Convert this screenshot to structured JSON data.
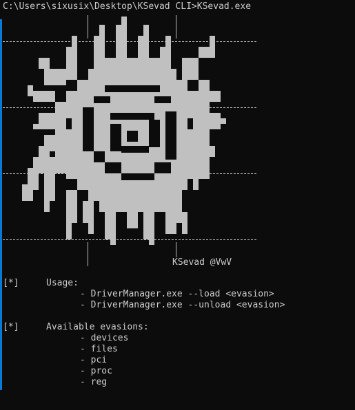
{
  "terminal": {
    "prompt": "C:\\Users\\sixusix\\Desktop\\KSevad CLI>",
    "command": "KSevad.exe"
  },
  "banner": {
    "signature": "KSevad @VwV"
  },
  "usage": {
    "marker": "[*]",
    "heading": "Usage:",
    "lines": [
      "- DriverManager.exe --load <evasion>",
      "- DriverManager.exe --unload <evasion>"
    ]
  },
  "evasions": {
    "marker": "[*]",
    "heading": "Available evasions:",
    "items": [
      "- devices",
      "- files",
      "- pci",
      "- proc",
      "- reg"
    ]
  },
  "colors": {
    "background": "#0c0c0c",
    "text": "#cccccc",
    "logo": "#c0c0c0",
    "accent": "#0a78d7"
  }
}
